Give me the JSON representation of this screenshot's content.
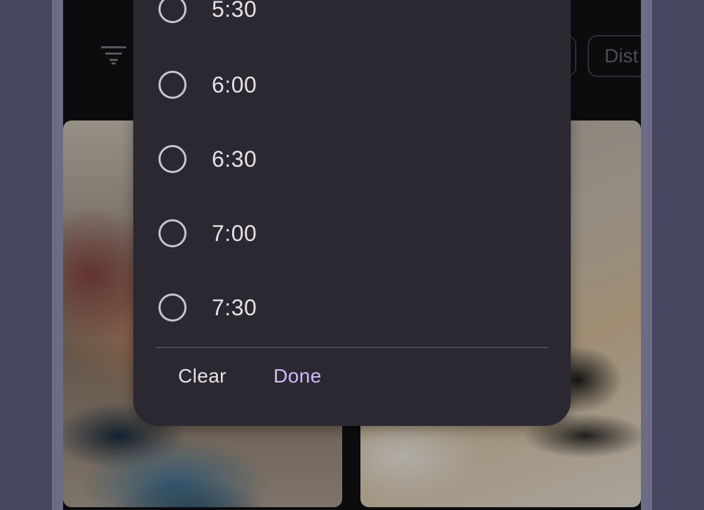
{
  "background": {
    "chips": [
      {
        "label": ""
      },
      {
        "label": "Dist"
      }
    ]
  },
  "dialog": {
    "options": [
      {
        "label": "5:30",
        "selected": false
      },
      {
        "label": "6:00",
        "selected": false
      },
      {
        "label": "6:30",
        "selected": false
      },
      {
        "label": "7:00",
        "selected": false
      },
      {
        "label": "7:30",
        "selected": false
      }
    ],
    "actions": {
      "clear_label": "Clear",
      "done_label": "Done"
    }
  },
  "colors": {
    "accent": "#cfbcff",
    "dialog_surface": "#2b2831",
    "text_primary": "#e6e1e5",
    "radio_outline": "#cac4d0"
  }
}
